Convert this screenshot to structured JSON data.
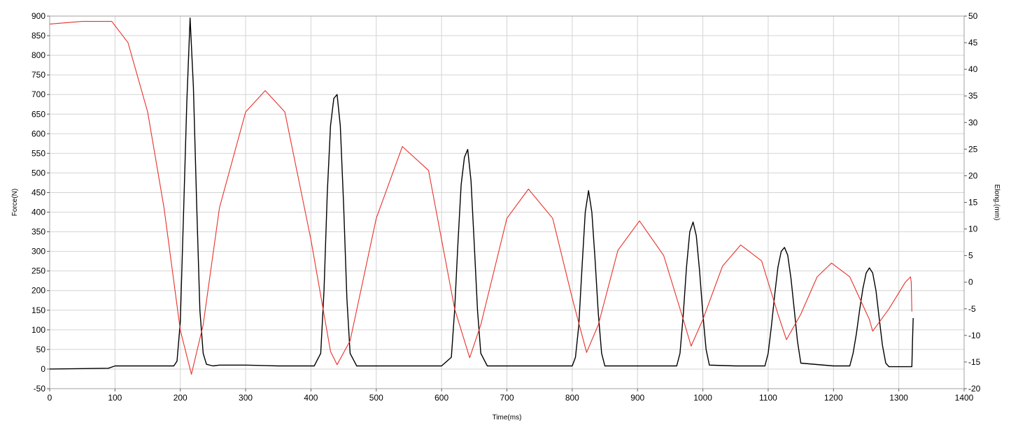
{
  "chart_data": {
    "type": "line",
    "xlabel": "Time(ms)",
    "ylabel": "Force(N)",
    "y2label": "Elong.(mm)",
    "xlim": [
      0,
      1400
    ],
    "ylim": [
      -50,
      900
    ],
    "y2lim": [
      -20,
      50
    ],
    "x_ticks": [
      0,
      100,
      200,
      300,
      400,
      500,
      600,
      700,
      800,
      900,
      1000,
      1100,
      1200,
      1300,
      1400
    ],
    "y_ticks": [
      -50,
      0,
      50,
      100,
      150,
      200,
      250,
      300,
      350,
      400,
      450,
      500,
      550,
      600,
      650,
      700,
      750,
      800,
      850,
      900
    ],
    "y2_ticks": [
      -20,
      -15,
      -10,
      -5,
      0,
      5,
      10,
      15,
      20,
      25,
      30,
      35,
      40,
      45,
      50
    ],
    "grid": true,
    "colors": {
      "force": "#000000",
      "elongation": "#e8312a",
      "grid": "#d4d4d4"
    },
    "series": [
      {
        "axis": "left",
        "color": "#000000",
        "x": [
          0,
          90,
          100,
          190,
          195,
          200,
          205,
          210,
          215,
          220,
          225,
          230,
          235,
          240,
          250,
          260,
          300,
          350,
          405,
          415,
          420,
          425,
          430,
          435,
          440,
          445,
          450,
          455,
          460,
          470,
          500,
          600,
          615,
          620,
          625,
          630,
          635,
          640,
          645,
          650,
          655,
          660,
          670,
          700,
          800,
          805,
          810,
          815,
          820,
          825,
          830,
          835,
          840,
          845,
          850,
          900,
          960,
          965,
          970,
          975,
          980,
          985,
          990,
          995,
          1000,
          1005,
          1010,
          1050,
          1095,
          1100,
          1105,
          1110,
          1115,
          1120,
          1125,
          1130,
          1135,
          1140,
          1145,
          1150,
          1200,
          1225,
          1230,
          1235,
          1240,
          1245,
          1250,
          1255,
          1260,
          1265,
          1270,
          1275,
          1280,
          1285,
          1300,
          1320,
          1321,
          1322
        ],
        "y": [
          0,
          2,
          8,
          8,
          20,
          120,
          400,
          680,
          895,
          720,
          420,
          150,
          40,
          12,
          8,
          10,
          10,
          8,
          8,
          40,
          200,
          450,
          620,
          690,
          700,
          620,
          420,
          180,
          40,
          8,
          8,
          8,
          30,
          150,
          320,
          470,
          540,
          560,
          480,
          320,
          150,
          40,
          8,
          8,
          8,
          30,
          110,
          260,
          400,
          455,
          400,
          280,
          140,
          40,
          8,
          8,
          8,
          40,
          140,
          260,
          350,
          375,
          340,
          250,
          140,
          50,
          10,
          8,
          8,
          40,
          110,
          190,
          260,
          300,
          310,
          290,
          230,
          150,
          70,
          15,
          8,
          8,
          40,
          90,
          150,
          205,
          245,
          258,
          245,
          200,
          130,
          60,
          15,
          6,
          6,
          6,
          70,
          130
        ]
      },
      {
        "axis": "right",
        "color": "#e8312a",
        "x": [
          0,
          50,
          95,
          120,
          150,
          175,
          200,
          217,
          235,
          260,
          300,
          330,
          360,
          400,
          430,
          440,
          460,
          500,
          540,
          580,
          620,
          643,
          660,
          700,
          733,
          770,
          800,
          822,
          840,
          870,
          903,
          940,
          970,
          982,
          1000,
          1030,
          1058,
          1090,
          1115,
          1128,
          1150,
          1175,
          1197,
          1225,
          1255,
          1260,
          1285,
          1310,
          1318,
          1319,
          1320
        ],
        "y": [
          48.5,
          49,
          49,
          45,
          32,
          14,
          -9,
          -17.3,
          -8,
          14,
          32,
          36,
          32,
          8,
          -13,
          -15.5,
          -11,
          12,
          25.5,
          21,
          -5,
          -14.2,
          -8,
          12,
          17.5,
          12,
          -3,
          -13.2,
          -8,
          6,
          11.5,
          5,
          -7,
          -12,
          -7,
          3,
          7,
          4,
          -6,
          -10.8,
          -6,
          1,
          3.6,
          1,
          -7,
          -9.2,
          -5,
          0,
          1,
          0,
          -5.5
        ]
      }
    ]
  }
}
